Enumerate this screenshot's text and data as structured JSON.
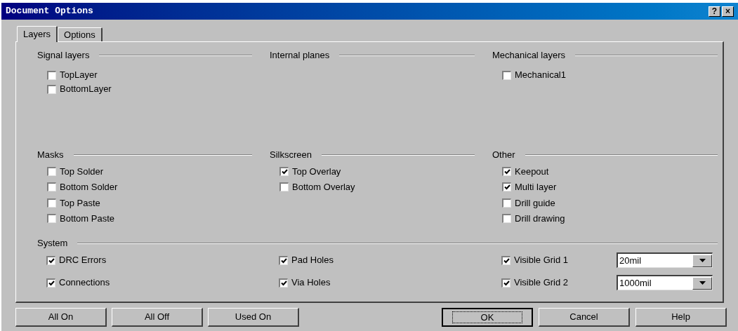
{
  "window": {
    "title": "Document Options",
    "title_buttons": [
      {
        "label": "?"
      },
      {
        "label": "×"
      }
    ]
  },
  "tabs": [
    {
      "label": "Layers",
      "selected": true
    },
    {
      "label": "Options",
      "selected": false
    }
  ],
  "groups": [
    {
      "title": "Signal layers",
      "items": [
        {
          "label": "TopLayer",
          "checked": false
        },
        {
          "label": "BottomLayer",
          "checked": false
        }
      ]
    },
    {
      "title": "Internal planes"
    },
    {
      "title": "Mechanical layers",
      "items": [
        {
          "label": "Mechanical1",
          "checked": false
        }
      ]
    },
    {
      "title": "Masks",
      "items": [
        {
          "label": "Top Solder",
          "checked": false
        },
        {
          "label": "Bottom Solder",
          "checked": false
        },
        {
          "label": "Top Paste",
          "checked": false
        },
        {
          "label": "Bottom Paste",
          "checked": false
        }
      ]
    },
    {
      "title": "Silkscreen",
      "items": [
        {
          "label": "Top Overlay",
          "checked": true
        },
        {
          "label": "Bottom Overlay",
          "checked": false
        }
      ]
    },
    {
      "title": "Other",
      "items": [
        {
          "label": "Keepout",
          "checked": true
        },
        {
          "label": "Multi layer",
          "checked": true
        },
        {
          "label": "Drill guide",
          "checked": false
        },
        {
          "label": "Drill drawing",
          "checked": false
        }
      ]
    }
  ],
  "system": {
    "title": "System",
    "columns": [
      [
        {
          "kind": "checkbox",
          "label": "DRC Errors",
          "checked": true
        },
        {
          "kind": "checkbox",
          "label": "Connections",
          "checked": true
        }
      ],
      [
        {
          "kind": "checkbox",
          "label": "Pad Holes",
          "checked": true
        },
        {
          "kind": "checkbox",
          "label": "Via Holes",
          "checked": true
        }
      ],
      [
        {
          "kind": "grid",
          "label": "Visible Grid 1",
          "checked": true,
          "value": "20mil"
        },
        {
          "kind": "grid",
          "label": "Visible Grid 2",
          "checked": true,
          "value": "1000mil"
        }
      ]
    ]
  },
  "buttons_left": [
    {
      "label": "All On"
    },
    {
      "label": "All Off"
    },
    {
      "label": "Used On"
    }
  ],
  "buttons_right": [
    {
      "label": "OK",
      "default": true
    },
    {
      "label": "Cancel",
      "default": false
    },
    {
      "label": "Help",
      "default": false
    }
  ]
}
